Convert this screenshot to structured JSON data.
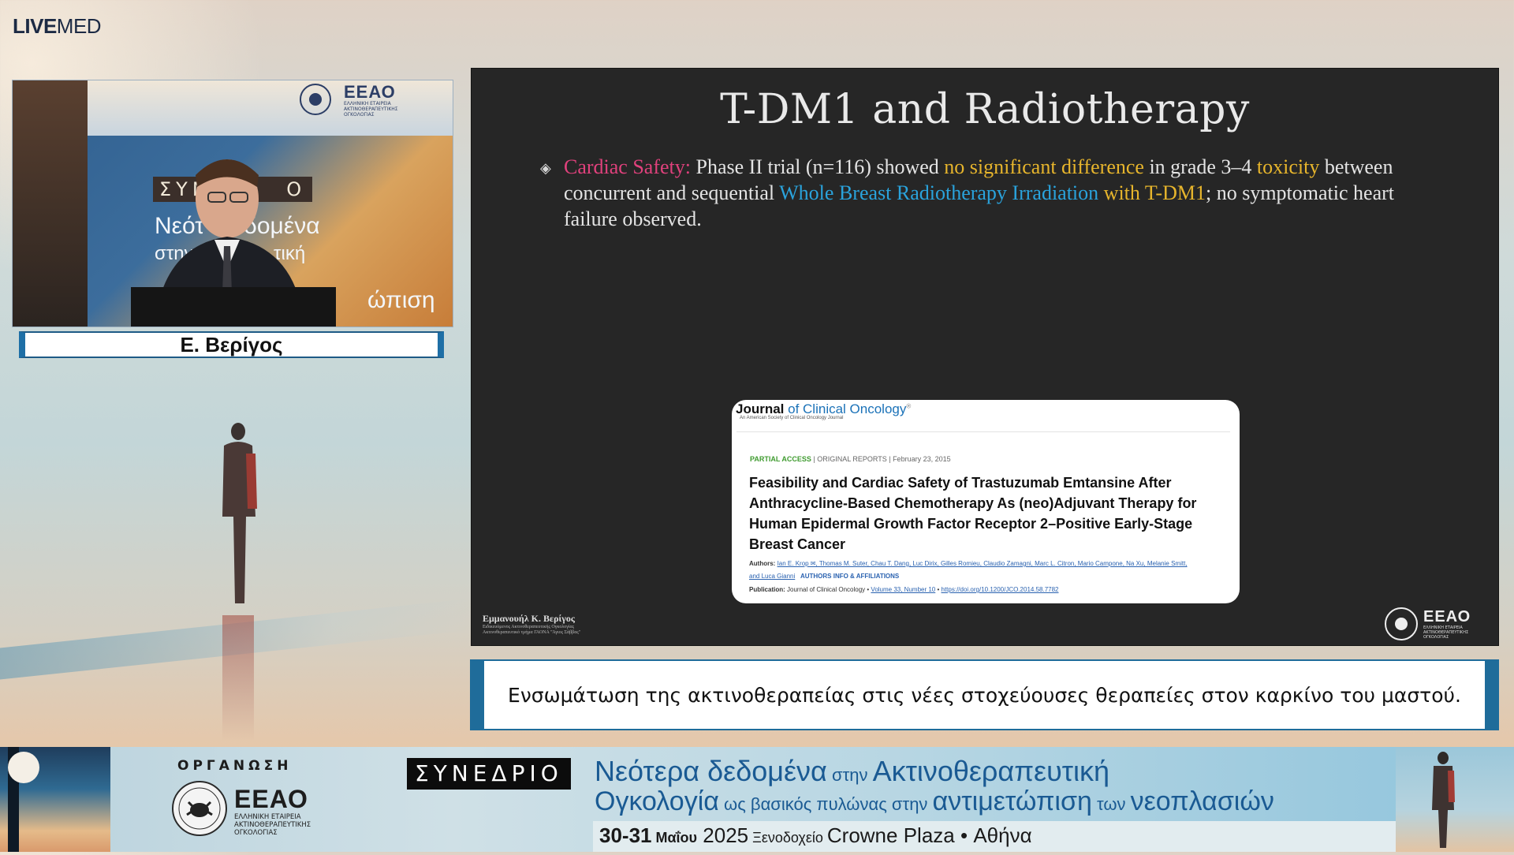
{
  "brand": {
    "live": "LIVE",
    "med": "MED"
  },
  "speaker": {
    "name": "Ε. Βερίγος",
    "video_backdrop": {
      "logo_text": "ΕΕΑΟ",
      "logo_sub": "ΕΛΛΗΝΙΚΗ ΕΤΑΙΡΕΙΑ ΑΚΤΙΝΟΘΕΡΑΠΕΥΤΙΚΗΣ ΟΓΚΟΛΟΓΙΑΣ",
      "syn_fragment": "ΣΥΝ",
      "syn_end": "Ο",
      "line1a": "Νεότ",
      "line1b": "δομένα",
      "line2a": "στην Α",
      "line2b": "τική",
      "line3": "ώπιση"
    }
  },
  "slide": {
    "title": "T-DM1 and Radiotherapy",
    "bullet": {
      "label": "Cardiac Safety:",
      "t1": " Phase II trial (n=116) showed ",
      "h1": "no significant difference",
      "t2": " in grade 3–4 ",
      "h2": "toxicity",
      "t3": " between concurrent and sequential ",
      "h3": "Whole Breast Radiotherapy Irradiation",
      "t4": " ",
      "h4": "with T-DM1",
      "t5": "; no symptomatic heart failure observed."
    },
    "journal": {
      "name_bold": "Journal",
      "name_rest": " of Clinical Oncology",
      "tm": "®",
      "subtitle": "An American Society of Clinical Oncology Journal",
      "access": "PARTIAL ACCESS",
      "sep": " | ",
      "type": "ORIGINAL REPORTS",
      "date": "February 23, 2015",
      "title": "Feasibility and Cardiac Safety of Trastuzumab Emtansine After Anthracycline-Based Chemotherapy As (neo)Adjuvant Therapy for Human Epidermal Growth Factor Receptor 2–Positive Early-Stage Breast Cancer",
      "authors_label": "Authors:",
      "authors": "Ian E. Krop ✉, Thomas M. Suter, Chau T. Dang, Luc Dirix, Gilles Romieu, Claudio Zamagni, Marc L. Citron, Mario Campone, Na Xu, Melanie Smitt, and Luca Gianni",
      "authors_info": "AUTHORS INFO & AFFILIATIONS",
      "pub_label": "Publication:",
      "pub_journal": " Journal of Clinical Oncology • ",
      "pub_volume": "Volume 33, Number 10",
      "pub_sep": " • ",
      "pub_doi": "https://doi.org/10.1200/JCO.2014.58.7782"
    },
    "author": {
      "name": "Εμμανουήλ Κ. Βερίγος",
      "sub1": "Ειδικευόμενος Ακτινοθεραπευτικής Ογκολογίας",
      "sub2": "Ακτινοθεραπευτικό τμήμα ΓΑΟΝΑ \"Άγιος Σάββας\""
    },
    "logo": {
      "text": "ΕΕΑΟ",
      "sub": "ΕΛΛΗΝΙΚΗ ΕΤΑΙΡΕΙΑ ΑΚΤΙΝΟΘΕΡΑΠΕΥΤΙΚΗΣ ΟΓΚΟΛΟΓΙΑΣ"
    }
  },
  "caption": "Ενσωμάτωση της ακτινοθεραπείας στις νέες στοχεύουσες θεραπείες στον καρκίνο του μαστού.",
  "banner": {
    "org_label": "ΟΡΓΑΝΩΣΗ",
    "org_logo_text": "ΕΕΑΟ",
    "org_logo_sub1": "ΕΛΛΗΝΙΚΗ ΕΤΑΙΡΕΙΑ",
    "org_logo_sub2": "ΑΚΤΙΝΟΘΕΡΑΠΕΥΤΙΚΗΣ",
    "org_logo_sub3": "ΟΓΚΟΛΟΓΙΑΣ",
    "conf_label": "ΣΥΝΕΔΡΙΟ",
    "line1_a": "Νεότερα δεδομένα",
    "line1_b": " στην ",
    "line1_c": "Ακτινοθεραπευτική",
    "line2_a": "Ογκολογία",
    "line2_b": " ως βασικός πυλώνας ",
    "line2_c": "στην ",
    "line2_d": "αντιμετώπιση",
    "line2_e": " των ",
    "line2_f": "νεοπλασιών",
    "date_bold": "30-31",
    "date_month": " Μαΐου",
    "date_year": " 2025",
    "venue_pre": " Ξενοδοχείο ",
    "venue": "Crowne Plaza",
    "venue_sep": " • ",
    "city": "Αθήνα"
  },
  "colors": {
    "accent_pink": "#e0417c",
    "accent_gold": "#e7b52c",
    "accent_blue": "#2aa3dc",
    "brand_blue": "#1a5a93",
    "frame_blue": "#1f6c9a"
  }
}
